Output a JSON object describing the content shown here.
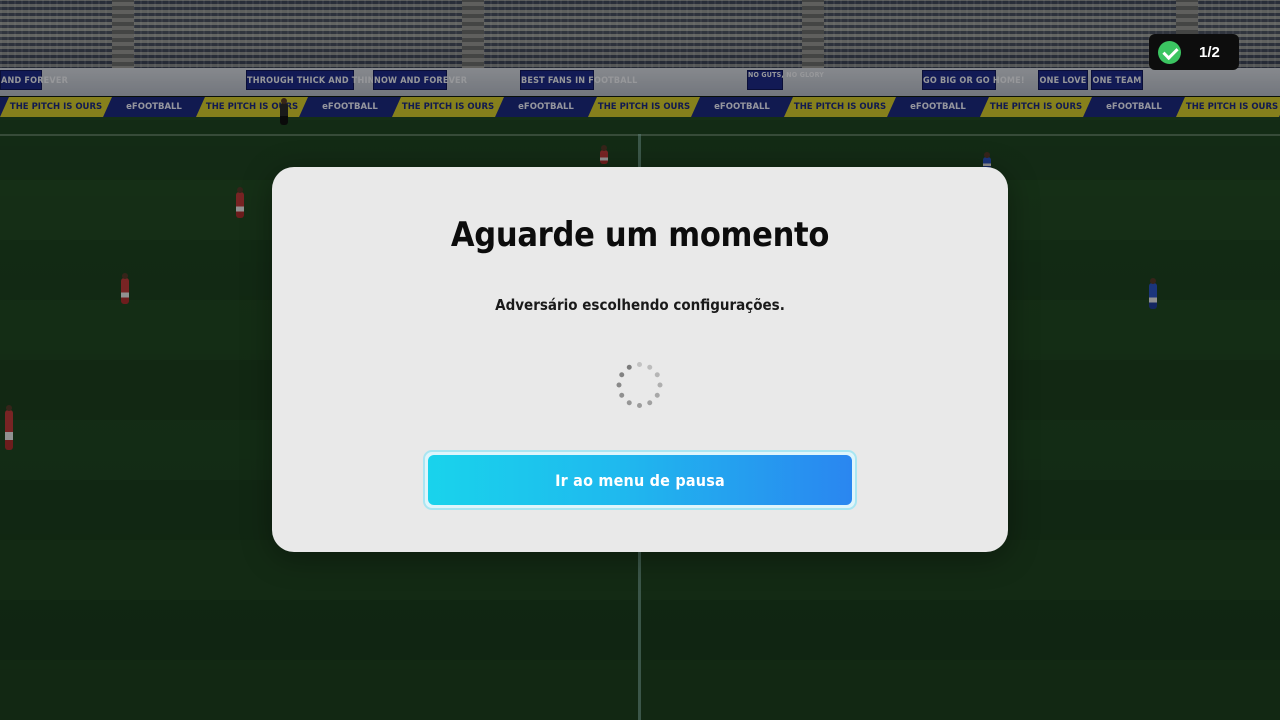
{
  "stadium": {
    "banners": [
      "AND FOREVER",
      "THROUGH THICK AND THIN",
      "NOW AND FOREVER",
      "BEST FANS IN FOOTBALL",
      "NO GUTS, NO GLORY",
      "GO BIG OR GO HOME!",
      "ONE LOVE",
      "ONE TEAM"
    ],
    "adboard": {
      "slogan": "THE PITCH IS OURS",
      "brand": "eFOOTBALL"
    }
  },
  "hud": {
    "ready_count": "1/2",
    "ready_icon": "checkmark-icon",
    "ready_color": "#3bc461"
  },
  "dialog": {
    "title": "Aguarde um momento",
    "message": "Adversário escolhendo configurações.",
    "loading_icon": "spinner-icon",
    "pause_button_label": "Ir ao menu de pausa",
    "button_gradient": [
      "#19d3ec",
      "#2a86f0"
    ]
  }
}
